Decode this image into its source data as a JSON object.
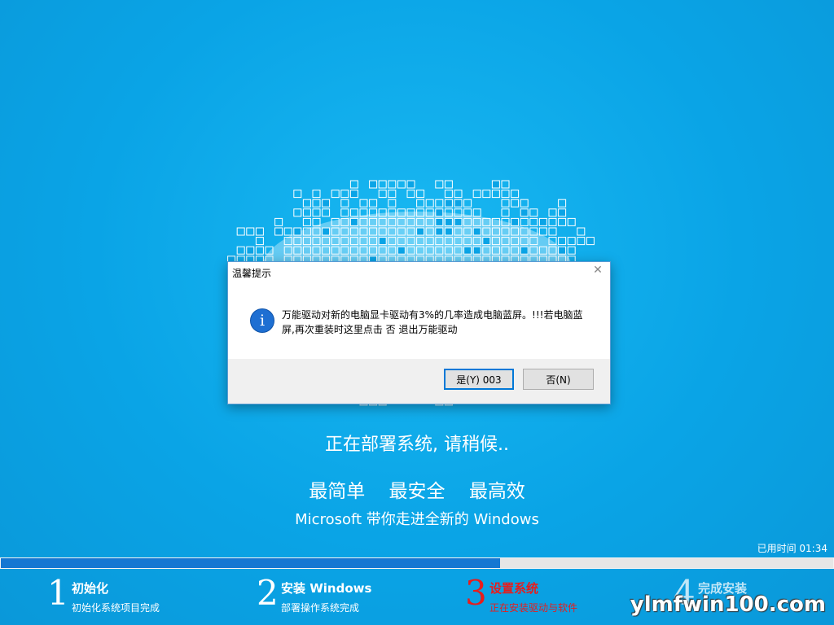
{
  "dialog": {
    "title": "温馨提示",
    "message": "万能驱动对新的电脑显卡驱动有3%的几率造成电脑蓝屏。!!!若电脑蓝屏,再次重装时这里点击 否 退出万能驱动",
    "yes_label": "是(Y) 003",
    "no_label": "否(N)",
    "close_glyph": "✕",
    "info_glyph": "i"
  },
  "main": {
    "deploying": "正在部署系统, 请稍候..",
    "slogans": [
      "最简单",
      "最安全",
      "最高效"
    ],
    "tagline": "Microsoft 带你走进全新的 Windows"
  },
  "progress": {
    "elapsed_label": "已用时间 01:34",
    "fraction": 0.6
  },
  "steps": [
    {
      "number": "1",
      "title": "初始化",
      "subtitle": "初始化系统项目完成",
      "state": "done"
    },
    {
      "number": "2",
      "title": "安装 Windows",
      "subtitle": "部署操作系统完成",
      "state": "done"
    },
    {
      "number": "3",
      "title": "设置系统",
      "subtitle": "正在安装驱动与软件",
      "state": "active"
    },
    {
      "number": "4",
      "title": "完成安装",
      "subtitle": "",
      "state": "pending"
    }
  ],
  "watermark": "ylmfwin100.com",
  "colors": {
    "background": "#0aa4e6",
    "progress_fill": "#1577d2",
    "active_step": "#e81c1c",
    "info_icon": "#1e6fd2",
    "default_button_border": "#0078d7"
  }
}
